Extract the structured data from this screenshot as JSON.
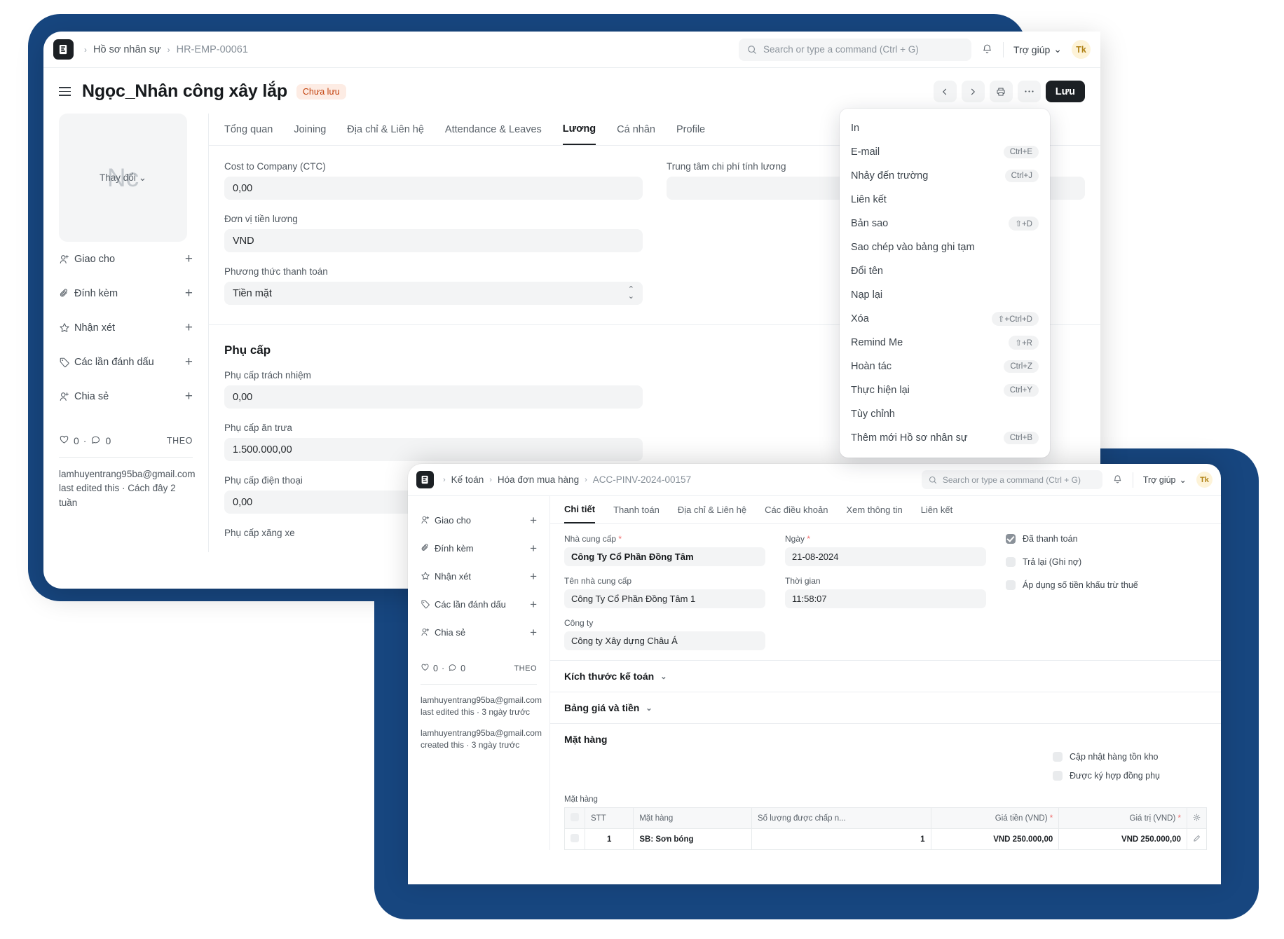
{
  "window1": {
    "breadcrumb": {
      "parent": "Hồ sơ nhân sự",
      "current": "HR-EMP-00061"
    },
    "search_placeholder": "Search or type a command (Ctrl + G)",
    "help_label": "Trợ giúp",
    "avatar_initials": "Tk",
    "doc_title": "Ngọc_Nhân công xây lắp",
    "status_badge": "Chưa lưu",
    "save_label": "Lưu",
    "photo_initials": "Nc",
    "photo_change_label": "Thay đổi",
    "sidebar_items": [
      {
        "label": "Giao cho",
        "icon": "assign-user-icon"
      },
      {
        "label": "Đính kèm",
        "icon": "paperclip-icon"
      },
      {
        "label": "Nhận xét",
        "icon": "star-icon"
      },
      {
        "label": "Các lần đánh dấu",
        "icon": "tag-icon"
      },
      {
        "label": "Chia sẻ",
        "icon": "share-user-icon"
      }
    ],
    "like_count": "0",
    "comment_count": "0",
    "follow_label": "THEO",
    "activity_log": "lamhuyentrang95ba@gmail.com last edited this · Cách đây 2 tuần",
    "tabs": [
      "Tổng quan",
      "Joining",
      "Địa chỉ & Liên hệ",
      "Attendance & Leaves",
      "Lương",
      "Cá nhân",
      "Profile"
    ],
    "active_tab": "Lương",
    "fields": {
      "ctc_label": "Cost to Company (CTC)",
      "ctc_value": "0,00",
      "payroll_cost_center_label": "Trung tâm chi phí tính lương",
      "payroll_cost_center_value": "",
      "currency_label": "Đơn vị tiền lương",
      "currency_value": "VND",
      "payment_method_label": "Phương thức thanh toán",
      "payment_method_value": "Tiền mặt"
    },
    "allowance_section": "Phụ cấp",
    "allowances": [
      {
        "label": "Phụ cấp trách nhiệm",
        "value": "0,00"
      },
      {
        "label": "Phụ cấp ăn trưa",
        "value": "1.500.000,00"
      },
      {
        "label": "Phụ cấp điện thoại",
        "value": "0,00"
      },
      {
        "label": "Phụ cấp xăng xe",
        "value": ""
      }
    ]
  },
  "menu": {
    "items": [
      {
        "label": "In",
        "shortcut": ""
      },
      {
        "label": "E-mail",
        "shortcut": "Ctrl+E"
      },
      {
        "label": "Nhảy đến trường",
        "shortcut": "Ctrl+J"
      },
      {
        "label": "Liên kết",
        "shortcut": ""
      },
      {
        "label": "Bản sao",
        "shortcut": "⇧+D"
      },
      {
        "label": "Sao chép vào bảng ghi tạm",
        "shortcut": ""
      },
      {
        "label": "Đổi tên",
        "shortcut": ""
      },
      {
        "label": "Nạp lại",
        "shortcut": ""
      },
      {
        "label": "Xóa",
        "shortcut": "⇧+Ctrl+D"
      },
      {
        "label": "Remind Me",
        "shortcut": "⇧+R"
      },
      {
        "label": "Hoàn tác",
        "shortcut": "Ctrl+Z"
      },
      {
        "label": "Thực hiện lại",
        "shortcut": "Ctrl+Y"
      },
      {
        "label": "Tùy chỉnh",
        "shortcut": ""
      },
      {
        "label": "Thêm mới Hồ sơ nhân sự",
        "shortcut": "Ctrl+B"
      }
    ]
  },
  "window2": {
    "breadcrumb": {
      "root": "Kế toán",
      "parent": "Hóa đơn mua hàng",
      "current": "ACC-PINV-2024-00157"
    },
    "search_placeholder": "Search or type a command (Ctrl + G)",
    "help_label": "Trợ giúp",
    "avatar_initials": "Tk",
    "sidebar_items": [
      {
        "label": "Giao cho",
        "icon": "assign-user-icon"
      },
      {
        "label": "Đính kèm",
        "icon": "paperclip-icon"
      },
      {
        "label": "Nhận xét",
        "icon": "star-icon"
      },
      {
        "label": "Các lần đánh dấu",
        "icon": "tag-icon"
      },
      {
        "label": "Chia sẻ",
        "icon": "share-user-icon"
      }
    ],
    "like_count": "0",
    "comment_count": "0",
    "follow_label": "THEO",
    "activity_log_1": "lamhuyentrang95ba@gmail.com last edited this · 3 ngày trước",
    "activity_log_2": "lamhuyentrang95ba@gmail.com created this · 3 ngày trước",
    "tabs": [
      "Chi tiết",
      "Thanh toán",
      "Địa chỉ & Liên hệ",
      "Các điều khoản",
      "Xem thông tin",
      "Liên kết"
    ],
    "active_tab": "Chi tiết",
    "fields": {
      "supplier_label": "Nhà cung cấp",
      "supplier_value": "Công Ty Cổ Phần Đồng Tâm",
      "supplier_name_label": "Tên nhà cung cấp",
      "supplier_name_value": "Công Ty Cổ Phần Đồng Tâm 1",
      "company_label": "Công ty",
      "company_value": "Công ty Xây dựng Châu Á",
      "date_label": "Ngày",
      "date_value": "21-08-2024",
      "time_label": "Thời gian",
      "time_value": "11:58:07"
    },
    "checkboxes": [
      {
        "label": "Đã thanh toán",
        "checked": true
      },
      {
        "label": "Trả lại (Ghi nợ)",
        "checked": false
      },
      {
        "label": "Áp dụng số tiền khấu trừ thuế",
        "checked": false
      }
    ],
    "sections": [
      {
        "label": "Kích thước kế toán"
      },
      {
        "label": "Bảng giá và tiền"
      }
    ],
    "items_heading": "Mặt hàng",
    "item_checkboxes": [
      {
        "label": "Cập nhật hàng tồn kho",
        "checked": false
      },
      {
        "label": "Được ký hợp đồng phụ",
        "checked": false
      }
    ],
    "table_label": "Mặt hàng",
    "table": {
      "columns": [
        "",
        "STT",
        "Mặt hàng",
        "Số lượng được chấp n...",
        "Giá tiền (VND)",
        "Giá trị (VND)",
        ""
      ],
      "rows": [
        {
          "stt": "1",
          "item": "SB: Sơn bóng",
          "qty": "1",
          "rate": "VND 250.000,00",
          "amount": "VND 250.000,00"
        }
      ]
    }
  },
  "colors": {
    "frame_blue": "#17467f",
    "dark": "#1c2024",
    "badge_bg": "#fdece4",
    "badge_fg": "#c2410c",
    "field_bg": "#f3f4f5"
  }
}
